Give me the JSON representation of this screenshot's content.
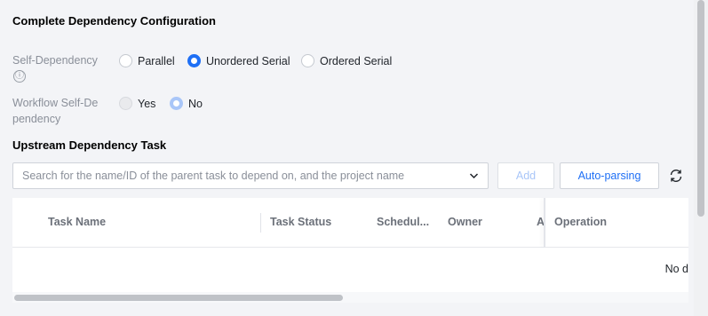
{
  "section1": {
    "title": "Complete Dependency Configuration"
  },
  "self_dependency": {
    "label": "Self-Dependency",
    "info_icon": "ⓘ",
    "options": [
      {
        "label": "Parallel",
        "checked": false
      },
      {
        "label": "Unordered Serial",
        "checked": true
      },
      {
        "label": "Ordered Serial",
        "checked": false
      }
    ]
  },
  "workflow_self_dependency": {
    "label": "Workflow Self-De pendency",
    "options": [
      {
        "label": "Yes",
        "checked": false,
        "disabled": true
      },
      {
        "label": "No",
        "checked": true,
        "disabled": true
      }
    ]
  },
  "section2": {
    "title": "Upstream Dependency Task"
  },
  "search": {
    "placeholder": "Search for the name/ID of the parent task to depend on, and the project name"
  },
  "buttons": {
    "add": "Add",
    "auto_parsing": "Auto-parsing"
  },
  "table": {
    "columns": [
      "Task Name",
      "Task Status",
      "Schedul...",
      "Owner",
      "As",
      "Operation"
    ],
    "empty_text": "No d"
  },
  "colors": {
    "accent": "#1e6ff5",
    "accent_disabled": "#a9c6f8",
    "page_bg": "#f3f4f7"
  }
}
